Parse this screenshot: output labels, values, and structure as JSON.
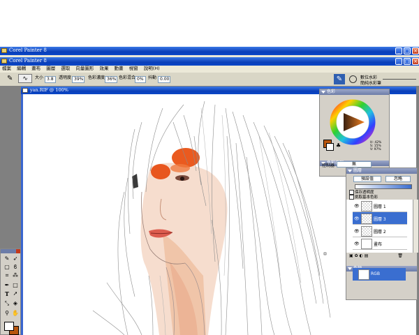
{
  "outer_window": {
    "title": "Corel Painter 8"
  },
  "app_window": {
    "title": "Corel Painter 8"
  },
  "menu": [
    "檔案",
    "編輯",
    "畫布",
    "圖層",
    "選取",
    "向量圖形",
    "效果",
    "動畫",
    "視窗",
    "說明(H)"
  ],
  "property_bar": {
    "size_label": "大小",
    "size_value": "3.8",
    "opacity_label": "透明度",
    "opacity_value": "39%",
    "resat_label": "色彩濃度",
    "resat_value": "36%",
    "bleed_label": "色彩混合",
    "bleed_value": "0%",
    "jitter_label": "抖動",
    "jitter_value": "0.00"
  },
  "brush_selector": {
    "category": "數位水彩",
    "variant": "簡純水彩筆"
  },
  "document": {
    "title": "yan.RIF @ 100%"
  },
  "colors_panel": {
    "title": "色彩",
    "readout": [
      "H: 42%",
      "S: 15%",
      "V: 97%"
    ],
    "main_color": "#b8560e"
  },
  "color_variability": {
    "title": "色彩表現",
    "label": "控制器",
    "value": "無"
  },
  "layers_panel": {
    "title": "圖層",
    "composite_method": "預設值",
    "composite_depth": "忽略",
    "preserve_transparency": "保存透明度",
    "pick_up_color": "挑取基本色彩",
    "layers": [
      {
        "name": "圖層 1",
        "selected": false
      },
      {
        "name": "圖層 3",
        "selected": true
      },
      {
        "name": "圖層 2",
        "selected": false
      },
      {
        "name": "畫布",
        "selected": false
      }
    ]
  },
  "channels_panel": {
    "title": "色頻",
    "item": "RGB"
  }
}
